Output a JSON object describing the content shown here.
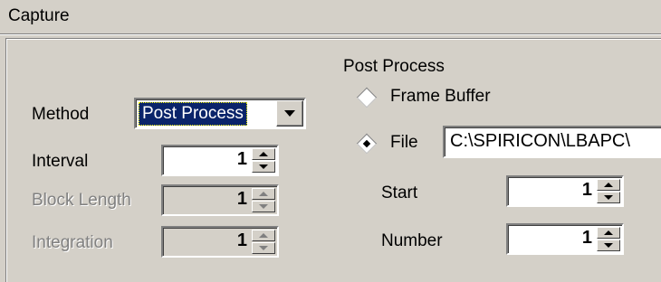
{
  "panel": {
    "title": "Capture"
  },
  "method": {
    "label": "Method",
    "selected": "Post Process"
  },
  "interval": {
    "label": "Interval",
    "value": "1"
  },
  "block_length": {
    "label": "Block Length",
    "value": "1",
    "enabled": false
  },
  "integration": {
    "label": "Integration",
    "value": "1",
    "enabled": false
  },
  "post_process": {
    "group_label": "Post Process",
    "options": [
      {
        "label": "Frame Buffer",
        "checked": false
      },
      {
        "label": "File",
        "checked": true
      }
    ],
    "file_path": "C:\\SPIRICON\\LBAPC\\",
    "start": {
      "label": "Start",
      "value": "1"
    },
    "number": {
      "label": "Number",
      "value": "1"
    }
  },
  "icons": {
    "combo_arrow": "chevron-down-icon",
    "spin_up": "spin-up-icon",
    "spin_down": "spin-down-icon"
  }
}
